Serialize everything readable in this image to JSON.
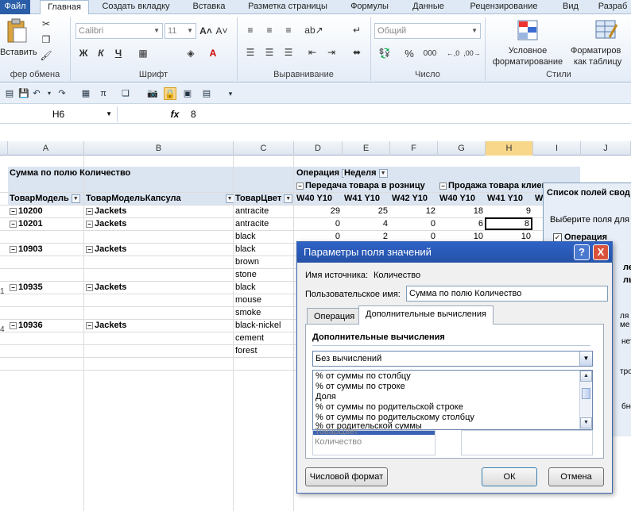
{
  "tabs": [
    {
      "label": "Файл"
    },
    {
      "label": "Главная"
    },
    {
      "label": "Создать вкладку"
    },
    {
      "label": "Вставка"
    },
    {
      "label": "Разметка страницы"
    },
    {
      "label": "Формулы"
    },
    {
      "label": "Данные"
    },
    {
      "label": "Рецензирование"
    },
    {
      "label": "Вид"
    },
    {
      "label": "Разраб"
    }
  ],
  "ribbon": {
    "paste_label": "Вставить",
    "clipboard_group": "фер обмена",
    "font_name": "Calibri",
    "font_size": "11",
    "font_group": "Шрифт",
    "alignment_group": "Выравнивание",
    "number_format": "Общий",
    "number_group": "Число",
    "conditional_label_1": "Условное",
    "conditional_label_2": "форматирование",
    "format_table_label_1": "Форматиров",
    "format_table_label_2": "как таблицу",
    "styles_group": "Стили",
    "bold": "Ж",
    "italic": "К",
    "underline": "Ч",
    "percent": "%",
    "thousands": "000",
    "colors": {
      "accent": "#2a5ea8"
    }
  },
  "formula_bar": {
    "cell_ref": "H6",
    "fx": "fx",
    "value": "8"
  },
  "columns": [
    "A",
    "B",
    "C",
    "D",
    "E",
    "F",
    "G",
    "H",
    "I",
    "J"
  ],
  "pivot": {
    "data_field": "Сумма по полю Количество",
    "col_field_1": "Операция",
    "col_field_2": "Неделя",
    "group_1": "Передача товара в розницу",
    "group_2": "Продажа товара клиен",
    "row_headers": [
      "ТоварМодель",
      "ТоварМодельКапсула",
      "ТоварЦвет"
    ],
    "weeks": [
      "W40 Y10",
      "W41 Y10",
      "W42 Y10",
      "W40 Y10",
      "W41 Y10",
      "W"
    ],
    "rows": [
      {
        "model": "10200",
        "capsule": "Jackets",
        "color": "antracite",
        "v": [
          "29",
          "25",
          "12",
          "18",
          "9"
        ]
      },
      {
        "model": "10201",
        "capsule": "Jackets",
        "color": "antracite",
        "v": [
          "0",
          "4",
          "0",
          "6",
          "8"
        ]
      },
      {
        "model": "",
        "capsule": "",
        "color": "black",
        "v": [
          "0",
          "2",
          "0",
          "10",
          "10"
        ]
      },
      {
        "model": "10903",
        "capsule": "Jackets",
        "color": "black",
        "v": [
          "",
          "",
          "",
          "",
          ""
        ]
      },
      {
        "model": "",
        "capsule": "",
        "color": "brown",
        "v": [
          "",
          "",
          "",
          "",
          ""
        ]
      },
      {
        "model": "",
        "capsule": "",
        "color": "stone",
        "v": [
          "",
          "",
          "",
          "",
          ""
        ]
      },
      {
        "model": "10935",
        "capsule": "Jackets",
        "color": "black",
        "v": [
          "",
          "",
          "",
          "",
          ""
        ]
      },
      {
        "model": "",
        "capsule": "",
        "color": "mouse",
        "v": [
          "",
          "",
          "",
          "",
          ""
        ]
      },
      {
        "model": "",
        "capsule": "",
        "color": "smoke",
        "v": [
          "",
          "",
          "",
          "",
          ""
        ]
      },
      {
        "model": "10936",
        "capsule": "Jackets",
        "color": "black-nickel",
        "v": [
          "",
          "",
          "",
          "",
          ""
        ]
      },
      {
        "model": "",
        "capsule": "",
        "color": "cement",
        "v": [
          "",
          "",
          "",
          "",
          ""
        ]
      },
      {
        "model": "",
        "capsule": "",
        "color": "forest",
        "v": [
          "",
          "",
          "",
          "",
          ""
        ]
      }
    ],
    "row_numbers": [
      "1",
      "4"
    ]
  },
  "field_list": {
    "title": "Список полей свод",
    "subtitle": "Выберите поля для",
    "item_1": "Операция",
    "frag_1": "ле",
    "frag_2": "ль",
    "frag_3": "ля ме",
    "frag_4": "нета",
    "frag_5": "трок",
    "frag_6": "бнов"
  },
  "dialog": {
    "title": "Параметры поля значений",
    "help": "?",
    "close": "X",
    "source_label": "Имя источника:",
    "source_value": "Количество",
    "custom_name_label": "Пользовательское имя:",
    "custom_name_value": "Сумма по полю Количество",
    "tab_operation": "Операция",
    "tab_additional": "Дополнительные вычисления",
    "section_title": "Дополнительные вычисления",
    "calc_selected": "Без вычислений",
    "options": [
      "% от суммы по столбцу",
      "% от суммы по строке",
      "Доля",
      "% от суммы по родительской строке",
      "% от суммы по родительскому столбцу",
      "% от родительской суммы"
    ],
    "behind_1": "ТоварЦвет",
    "behind_2": "Количество",
    "number_format_btn": "Числовой формат",
    "ok_btn": "ОК",
    "cancel_btn": "Отмена"
  }
}
